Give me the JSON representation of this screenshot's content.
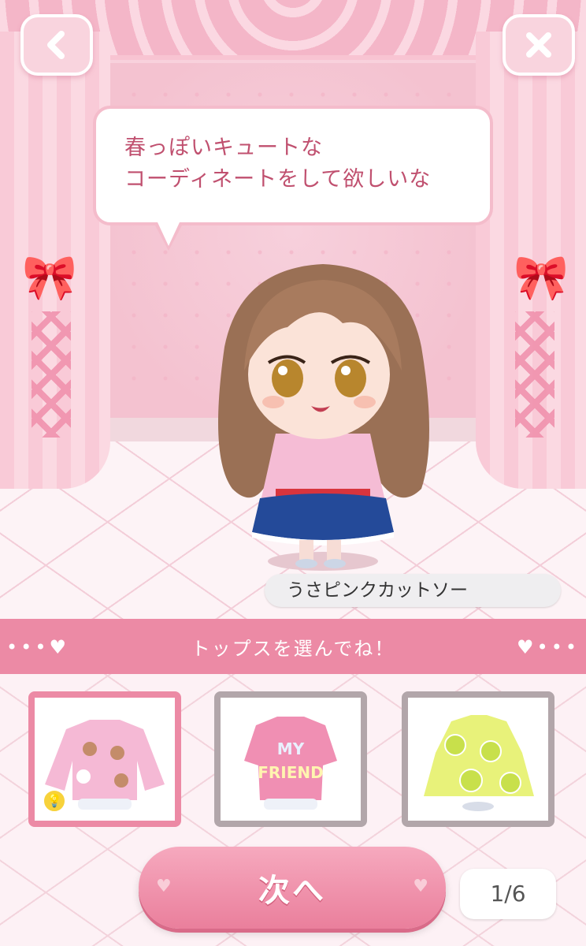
{
  "header": {
    "back_icon": "chevron-left-icon",
    "close_icon": "close-icon"
  },
  "speech": {
    "line1": "春っぽいキュートな",
    "line2": "コーディネートをして欲しいな"
  },
  "selected_item_name": "うさピンクカットソー",
  "banner": {
    "text": "トップスを選んでね！",
    "decor_left": "•••♥",
    "decor_right": "♥•••"
  },
  "items": [
    {
      "id": "usa-pink",
      "selected": true,
      "hint_icon": "lightbulb-icon",
      "print": ""
    },
    {
      "id": "my-friend",
      "selected": false,
      "print_line1": "MY",
      "print_line2": "FRIEND"
    },
    {
      "id": "lime",
      "selected": false,
      "print": ""
    }
  ],
  "footer": {
    "next_label": "次へ",
    "page_indicator": "1/6"
  },
  "colors": {
    "accent_pink": "#ec8aa5",
    "speech_text": "#c0506f",
    "card_border": "#b2a6aa"
  }
}
